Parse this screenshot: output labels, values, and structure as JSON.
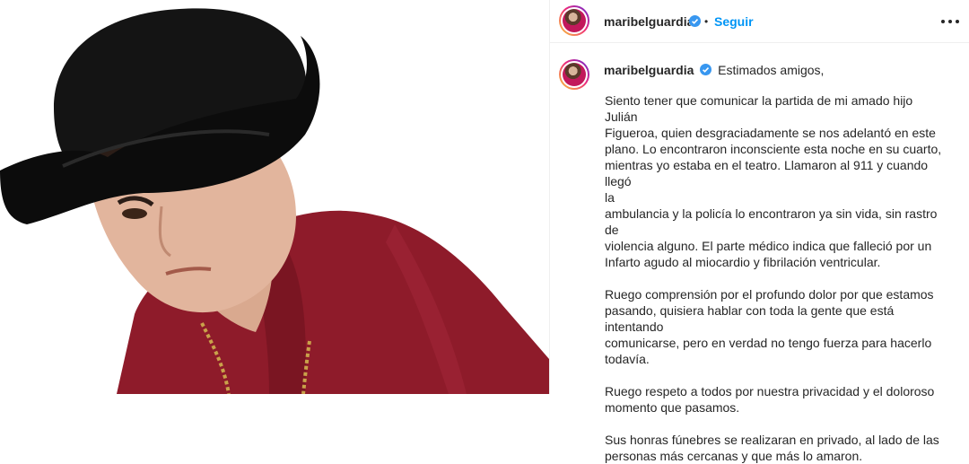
{
  "post": {
    "username": "maribelguardia",
    "follow_label": "Seguir",
    "separator": "•",
    "caption_lead": "Estimados amigos,",
    "caption_lines": [
      "Siento tener que comunicar la partida de mi amado hijo Julián",
      "Figueroa, quien desgraciadamente se nos adelantó en este",
      "plano. Lo encontraron inconsciente esta noche en su cuarto,",
      "mientras yo estaba en el teatro. Llamaron al 911 y cuando llegó",
      "la",
      "ambulancia y la policía lo encontraron ya sin vida, sin rastro de",
      "violencia alguno. El parte médico indica que falleció por un",
      "Infarto agudo al miocardio y fibrilación ventricular.",
      "",
      "Ruego comprensión por el profundo dolor por que estamos",
      "pasando, quisiera hablar con toda la gente que está intentando",
      "comunicarse, pero en verdad no tengo fuerza para hacerlo",
      "todavía.",
      "",
      "Ruego respeto a todos por nuestra privacidad y el doloroso",
      "momento que pasamos.",
      "",
      "Sus honras fúnebres se realizaran en privado, al lado de las",
      "personas más cercanas y que más lo amaron."
    ]
  },
  "icons": {
    "verified": "verified-badge-icon",
    "more": "more-options-icon"
  },
  "colors": {
    "link_blue": "#0095f6",
    "verified_blue": "#3897f0",
    "text": "#262626",
    "shirt": "#8e1b2a",
    "hat": "#111111"
  }
}
